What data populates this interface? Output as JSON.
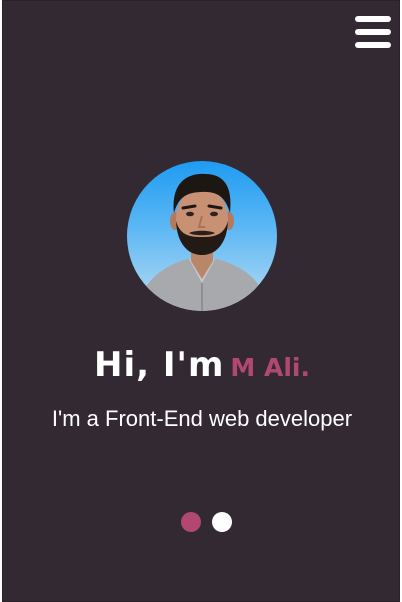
{
  "header": {
    "menu_icon": "hamburger-menu-icon"
  },
  "hero": {
    "avatar_alt": "profile photo",
    "greeting": "Hi, I'm",
    "name": "M Ali.",
    "subtitle": "I'm a Front-End web developer"
  },
  "slider": {
    "active_index": 0,
    "count": 2
  },
  "colors": {
    "background": "#322933",
    "accent": "#b04872",
    "text": "#ffffff"
  }
}
